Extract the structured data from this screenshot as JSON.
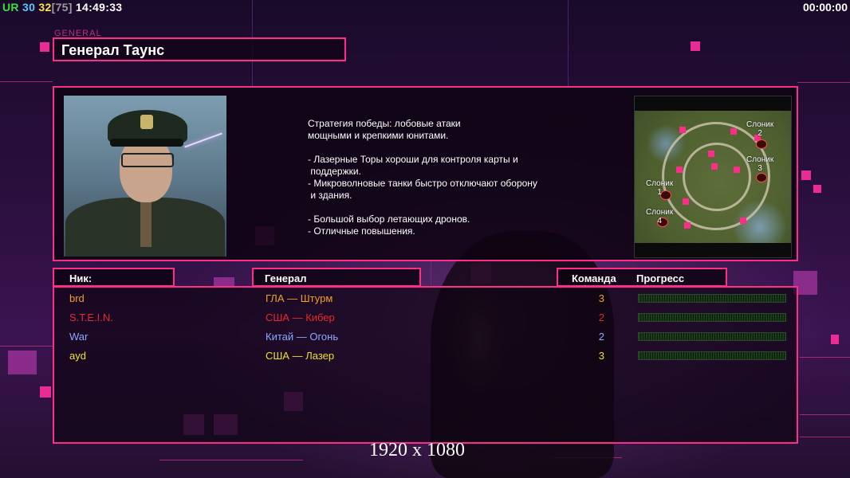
{
  "hud": {
    "ur_label": "UR",
    "stat1": "30",
    "stat2": "32",
    "stat3": "[75]",
    "clock": "14:49:33",
    "timer": "00:00:00"
  },
  "general": {
    "small_label": "GENERAL",
    "name": "Генерал Таунс",
    "description": [
      "Стратегия победы: лобовые атаки",
      "мощными и крепкими юнитами.",
      "",
      "- Лазерные Торы хороши для контроля карты и",
      " поддержки.",
      "- Микроволновые танки быстро отключают оборону",
      " и здания.",
      "",
      "- Большой выбор летающих дронов.",
      "- Отличные повышения."
    ]
  },
  "minimap": {
    "spots": [
      {
        "name": "Слоник",
        "num": "2"
      },
      {
        "name": "Слоник",
        "num": "3"
      },
      {
        "name": "Слоник",
        "num": "1"
      },
      {
        "name": "Слоник",
        "num": "4"
      }
    ]
  },
  "table": {
    "headers": {
      "nick": "Ник:",
      "general": "Генерал",
      "team": "Команда",
      "progress": "Прогресс"
    },
    "rows": [
      {
        "nick": "brd",
        "general": "ГЛА — Штурм",
        "team": "3",
        "color": "#f0a020",
        "progress": 0
      },
      {
        "nick": "S.T.E.I.N.",
        "general": "США — Кибер",
        "team": "2",
        "color": "#e8282c",
        "progress": 0
      },
      {
        "nick": "War",
        "general": "Китай — Огонь",
        "team": "2",
        "color": "#8ca8ff",
        "progress": 0
      },
      {
        "nick": "ayd",
        "general": "США — Лазер",
        "team": "3",
        "color": "#ece02a",
        "progress": 0
      }
    ]
  },
  "resolution": "1920 x 1080",
  "colors": {
    "accent": "#ff2d8a"
  }
}
